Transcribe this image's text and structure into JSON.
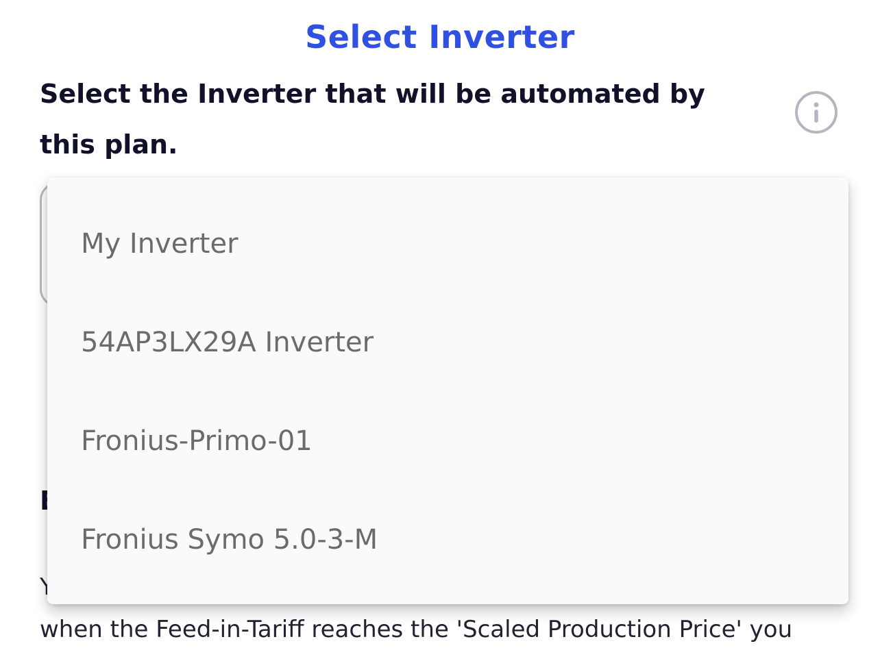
{
  "header": {
    "title": "Select Inverter",
    "instruction_line1": "Select the Inverter that will be automated by",
    "instruction_line2": "this plan."
  },
  "info_button": {
    "icon": "info-circle-icon"
  },
  "dropdown": {
    "options": [
      {
        "label": "My Inverter"
      },
      {
        "label": "54AP3LX29A Inverter"
      },
      {
        "label": "Fronius-Primo-01"
      },
      {
        "label": "Fronius Symo 5.0-3-M"
      }
    ]
  },
  "section": {
    "heading_visible": "E",
    "body_line1_visible": "Y",
    "body_line2": "when the Feed-in-Tariff reaches the 'Scaled Production Price' you"
  },
  "colors": {
    "title": "#2f50e0",
    "text_dark": "#11112a",
    "menu_text": "#6b6b6b",
    "menu_background": "#fafafa",
    "border_gray": "#b7b9bf"
  }
}
